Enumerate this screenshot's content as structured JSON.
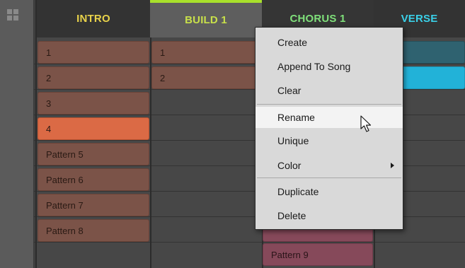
{
  "header": {
    "sections": [
      {
        "label": "INTRO",
        "color": "#e8d24a"
      },
      {
        "label": "BUILD 1",
        "color": "#c8e04a",
        "selected": true
      },
      {
        "label": "CHORUS 1",
        "color": "#7fe07a"
      },
      {
        "label": "VERSE",
        "color": "#3ad0e8"
      }
    ]
  },
  "patterns": {
    "intro": [
      "1",
      "2",
      "3",
      "4",
      "Pattern 5",
      "Pattern 6",
      "Pattern 7",
      "Pattern 8"
    ],
    "build": [
      "1",
      "2"
    ],
    "chorus": [
      "Pattern 9"
    ],
    "selected_pattern": "4"
  },
  "context_menu": {
    "items": [
      "Create",
      "Append To Song",
      "Clear",
      "Rename",
      "Unique",
      "Color",
      "Duplicate",
      "Delete"
    ],
    "hovered": "Rename",
    "submenu_item": "Color"
  },
  "colors": {
    "pattern_brown": "#7b5348",
    "pattern_selected": "#db6a45",
    "pattern_pink": "#86495a",
    "verse_cyan": "#22b2d8",
    "selected_tab_accent": "#a8e02b"
  },
  "icons": {
    "gutter": "grid-view-icon",
    "pointer": "mouse-pointer-icon",
    "submenu": "submenu-arrow-icon"
  }
}
